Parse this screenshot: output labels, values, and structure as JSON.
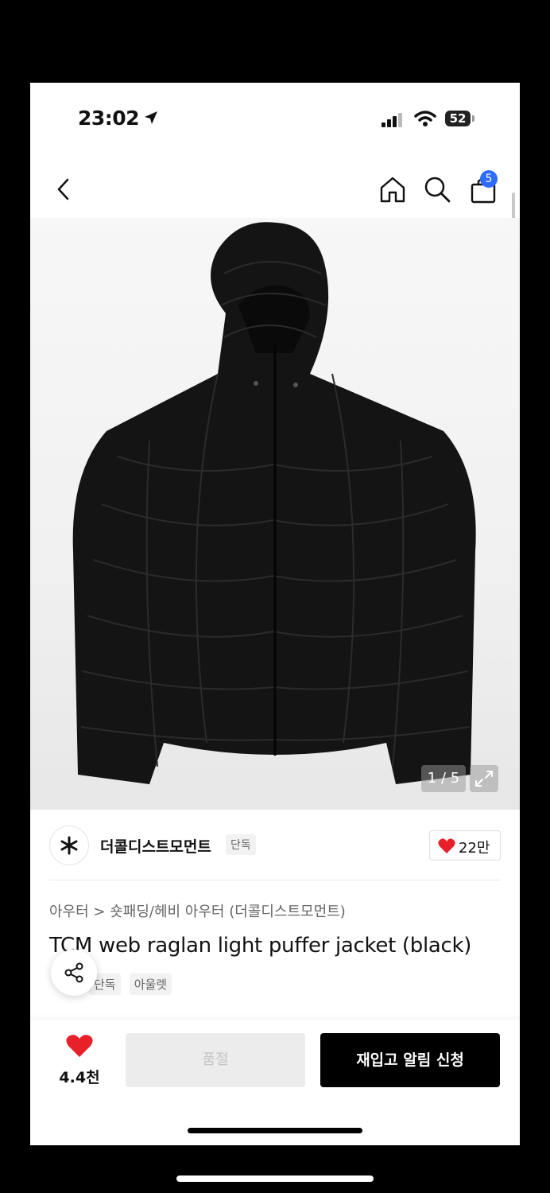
{
  "status_bar": {
    "time": "23:02",
    "battery": "52"
  },
  "nav": {
    "cart_count": "5"
  },
  "gallery": {
    "counter": "1 / 5"
  },
  "brand": {
    "name": "더콜디스트모먼트",
    "tag": "단독",
    "likes": "22만"
  },
  "product": {
    "breadcrumb": "아우터 > 숏패딩/헤비 아우터 (더콜디스트모먼트)",
    "title": "TCM web raglan light puffer jacket (black)",
    "tags": [
      "단독",
      "아울렛"
    ]
  },
  "bottom_bar": {
    "wish_count": "4.4천",
    "soldout_label": "품절",
    "restock_label": "재입고 알림 신청"
  },
  "colors": {
    "accent": "#2f6bff",
    "heart": "#e8202a",
    "cta": "#000000"
  }
}
